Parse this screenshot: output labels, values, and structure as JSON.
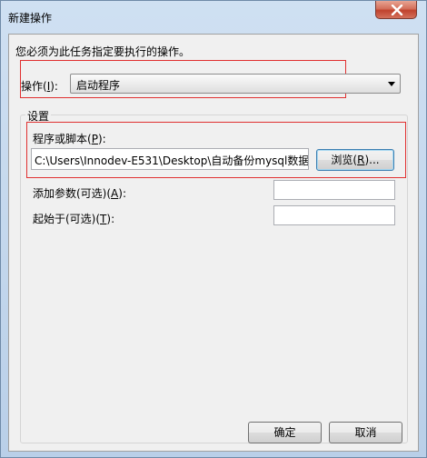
{
  "window": {
    "title": "新建操作"
  },
  "instruction": "您必须为此任务指定要执行的操作。",
  "action": {
    "label": "操作(I):",
    "value": "启动程序"
  },
  "settings": {
    "group_title": "设置",
    "program_label": "程序或脚本(P):",
    "program_value": "C:\\Users\\Innodev-E531\\Desktop\\自动备份mysql数据",
    "browse_label": "浏览(R)...",
    "args_label": "添加参数(可选)(A):",
    "args_value": "",
    "start_label": "起始于(可选)(T):",
    "start_value": ""
  },
  "buttons": {
    "ok": "确定",
    "cancel": "取消"
  }
}
